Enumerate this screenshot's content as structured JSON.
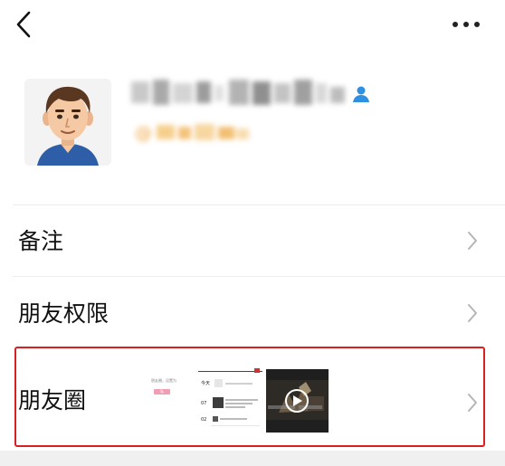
{
  "rows": {
    "remark": {
      "label": "备注"
    },
    "permissions": {
      "label": "朋友权限"
    },
    "moments": {
      "label": "朋友圈",
      "thumb1": {
        "line1": "朋友圈，设置为",
        "button": "私"
      },
      "thumb2": {
        "today": "今天",
        "date1": "07",
        "date2": "02"
      }
    }
  },
  "colors": {
    "highlight": "#d7201f",
    "verify": "#2f8fe0",
    "id_tint": "#f3b04a",
    "divider": "#ececec"
  }
}
